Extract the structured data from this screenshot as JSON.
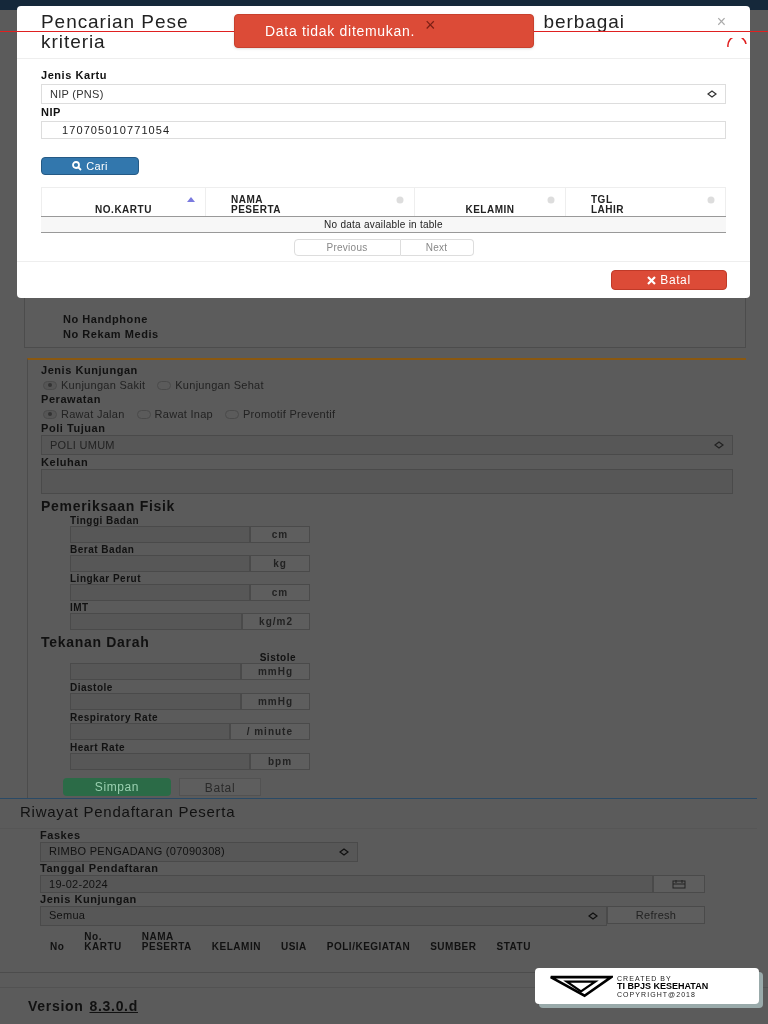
{
  "modal": {
    "title_parts": [
      "Pencarian Pese",
      "berbagai",
      "kriteria"
    ],
    "close": "×",
    "fields": [
      {
        "kind": "select",
        "label": "Jenis Kartu",
        "value": "NIP (PNS)"
      },
      {
        "kind": "input",
        "label": "NIP",
        "value": "170705010771054"
      }
    ],
    "search_button": "Cari",
    "table": {
      "columns": [
        {
          "lines": [
            "NO.KARTU"
          ],
          "sorted": true
        },
        {
          "lines": [
            "NAMA",
            "PESERTA"
          ],
          "sorted": false
        },
        {
          "lines": [
            "KELAMIN"
          ],
          "sorted": false
        },
        {
          "lines": [
            "TGL",
            "LAHIR"
          ],
          "sorted": false
        }
      ],
      "empty_message": "No data available in table"
    },
    "pagination": [
      "Previous",
      "Next"
    ],
    "cancel_button": "Batal"
  },
  "toast": {
    "message": "Data tidak ditemukan.",
    "close": "×"
  },
  "patient_info": {
    "rows": [
      "No Handphone",
      "No Rekam Medis"
    ]
  },
  "visit_form": {
    "jenis_kunjungan": {
      "label": "Jenis Kunjungan",
      "options": [
        {
          "label": "Kunjungan Sakit",
          "selected": true
        },
        {
          "label": "Kunjungan Sehat",
          "selected": false
        }
      ]
    },
    "perawatan": {
      "label": "Perawatan",
      "options": [
        {
          "label": "Rawat Jalan",
          "selected": true
        },
        {
          "label": "Rawat Inap",
          "selected": false
        },
        {
          "label": "Promotif Preventif",
          "selected": false
        }
      ]
    },
    "poli_tujuan": {
      "label": "Poli Tujuan",
      "value": "POLI UMUM"
    },
    "keluhan": {
      "label": "Keluhan"
    },
    "pemeriksaan_fisik": {
      "heading": "Pemeriksaan Fisik",
      "fields": [
        {
          "label": "Tinggi Badan",
          "unit": "cm"
        },
        {
          "label": "Berat Badan",
          "unit": "kg"
        },
        {
          "label": "Lingkar Perut",
          "unit": "cm"
        },
        {
          "label": "IMT",
          "unit": "kg/m2"
        }
      ]
    },
    "tekanan_darah": {
      "heading": "Tekanan Darah",
      "fields": [
        {
          "kind": "label_right",
          "label": "Sistole",
          "unit": "mmHg"
        },
        {
          "kind": "label_left",
          "label": "Diastole",
          "unit": "mmHg"
        },
        {
          "kind": "label_left",
          "label": "Respiratory Rate",
          "unit": "/ minute"
        },
        {
          "kind": "label_left",
          "label": "Heart Rate",
          "unit": "bpm"
        }
      ]
    },
    "buttons": {
      "save": "Simpan",
      "cancel": "Batal"
    }
  },
  "history": {
    "title": "Riwayat Pendaftaran Peserta",
    "faskes": {
      "label": "Faskes",
      "value": "RIMBO PENGADANG (07090308)"
    },
    "tanggal": {
      "label": "Tanggal Pendaftaran",
      "value": "19-02-2024"
    },
    "jenis": {
      "label": "Jenis Kunjungan",
      "value": "Semua",
      "button": "Refresh"
    },
    "columns": [
      {
        "lines": [
          "No"
        ]
      },
      {
        "lines": [
          "No.",
          "KARTU"
        ]
      },
      {
        "lines": [
          "NAMA",
          "PESERTA"
        ]
      },
      {
        "lines": [
          "KELAMIN"
        ]
      },
      {
        "lines": [
          "USIA"
        ]
      },
      {
        "lines": [
          "POLI/KEGIATAN"
        ]
      },
      {
        "lines": [
          "SUMBER"
        ]
      },
      {
        "lines": [
          "STATU"
        ]
      }
    ]
  },
  "badge": {
    "lines": [
      "CREATED BY",
      "TI BPJS KESEHATAN",
      "COPYRIGHT@2018"
    ]
  },
  "footer": {
    "label": "Version",
    "version": "8.3.0.d"
  }
}
